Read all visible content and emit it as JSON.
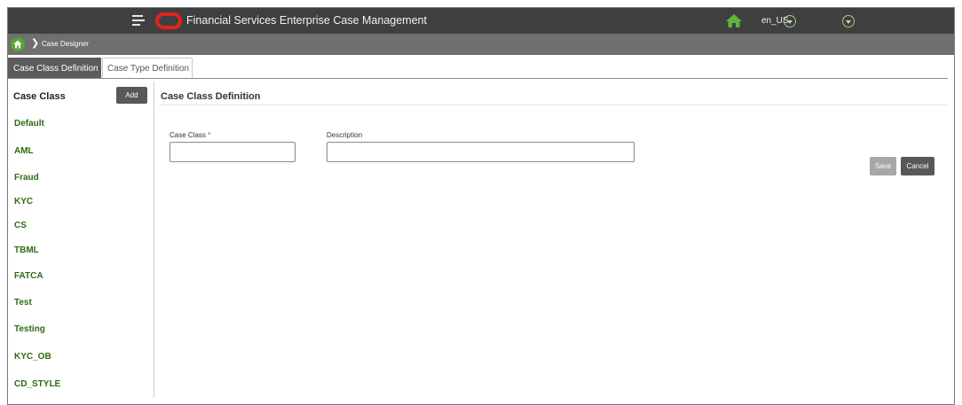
{
  "header": {
    "app_title": "Financial Services Enterprise Case Management",
    "locale": "en_US",
    "brand_color": "#e2231a"
  },
  "breadcrumb": {
    "items": [
      "Case Designer"
    ]
  },
  "tabs": [
    {
      "label": "Case Class Definition",
      "active": true
    },
    {
      "label": "Case Type Definition",
      "active": false
    }
  ],
  "sidebar": {
    "title": "Case Class",
    "add_label": "Add",
    "items": [
      "Default",
      "AML",
      "Fraud",
      "KYC",
      "CS",
      "TBML",
      "FATCA",
      "Test",
      "Testing",
      "KYC_OB",
      "CD_STYLE"
    ]
  },
  "form": {
    "title": "Case Class Definition",
    "case_class_label": "Case Class",
    "required_marker": "*",
    "case_class_value": "",
    "description_label": "Description",
    "description_value": "",
    "save_label": "Save",
    "cancel_label": "Cancel"
  },
  "icons": {
    "menu": "hamburger-icon",
    "logo": "oracle-logo",
    "home": "home-icon",
    "dropdown": "chevron-down-circle-icon",
    "breadcrumb_separator": "chevron-right-icon"
  }
}
